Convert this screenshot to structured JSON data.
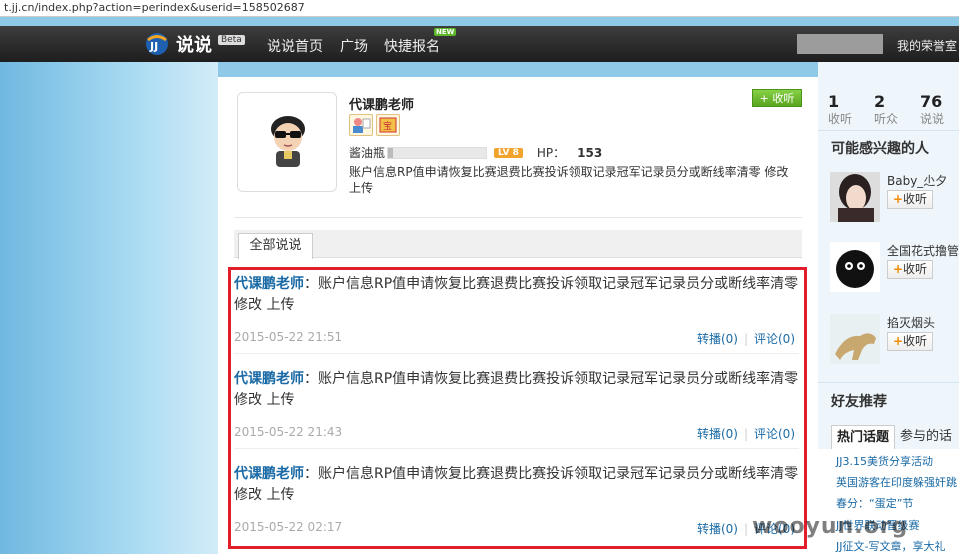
{
  "browser": {
    "url": "t.jj.cn/index.php?action=perindex&userid=158502687"
  },
  "nav": {
    "logo_text": "说说",
    "beta_label": "Beta",
    "links": [
      "说说首页",
      "广场",
      "快捷报名"
    ],
    "new_badge": "NEW",
    "my_honor": "我的荣誉室"
  },
  "profile": {
    "name": "代课鹏老师",
    "follow_label": "+ 收听",
    "rank_label": "酱油瓶",
    "level_label": "LV 8",
    "progress": 0.05,
    "hp_label": "HP：",
    "hp_value": "153",
    "bio": "账户信息RP值申请恢复比赛退费比赛投诉领取记录冠军记录员分或断线率清零 修改 上传"
  },
  "tabs": {
    "all_label": "全部说说"
  },
  "posts": [
    {
      "author": "代课鹏老师",
      "colon": "：",
      "text": "账户信息RP值申请恢复比赛退费比赛投诉领取记录冠军记录员分或断线率清零 修改 上传",
      "time": "2015-05-22 21:51",
      "repost": "转播(0)",
      "comment": "评论(0)"
    },
    {
      "author": "代课鹏老师",
      "colon": "：",
      "text": "账户信息RP值申请恢复比赛退费比赛投诉领取记录冠军记录员分或断线率清零 修改 上传",
      "time": "2015-05-22 21:43",
      "repost": "转播(0)",
      "comment": "评论(0)"
    },
    {
      "author": "代课鹏老师",
      "colon": "：",
      "text": "账户信息RP值申请恢复比赛退费比赛投诉领取记录冠军记录员分或断线率清零 修改 上传",
      "time": "2015-05-22 02:17",
      "repost": "转播(0)",
      "comment": "评论(0)"
    }
  ],
  "sidebar": {
    "stats": [
      {
        "num": "1",
        "label": "收听"
      },
      {
        "num": "2",
        "label": "听众"
      },
      {
        "num": "76",
        "label": "说说"
      }
    ],
    "interest_title": "可能感兴趣的人",
    "people": [
      {
        "name": "Baby_尐夕",
        "follow": "收听"
      },
      {
        "name": "全国花式撸管",
        "follow": "收听"
      },
      {
        "name": "掐灭烟头",
        "follow": "收听"
      }
    ],
    "friends_title": "好友推荐",
    "hot_tabs": [
      "热门话题",
      "参与的话"
    ],
    "hot_items": [
      "JJ3.15美货分享活动",
      "英国游客在印度躲强奸跳",
      "春分：“蛋定”节",
      "JJ世界联动晋级赛",
      "JJ征文-写文章，享大礼"
    ]
  },
  "watermark": "wooyun.org",
  "colors": {
    "accent_link": "#1a6aa6",
    "highlight_border": "#e21e2c",
    "follow_green": "#5aa520"
  }
}
